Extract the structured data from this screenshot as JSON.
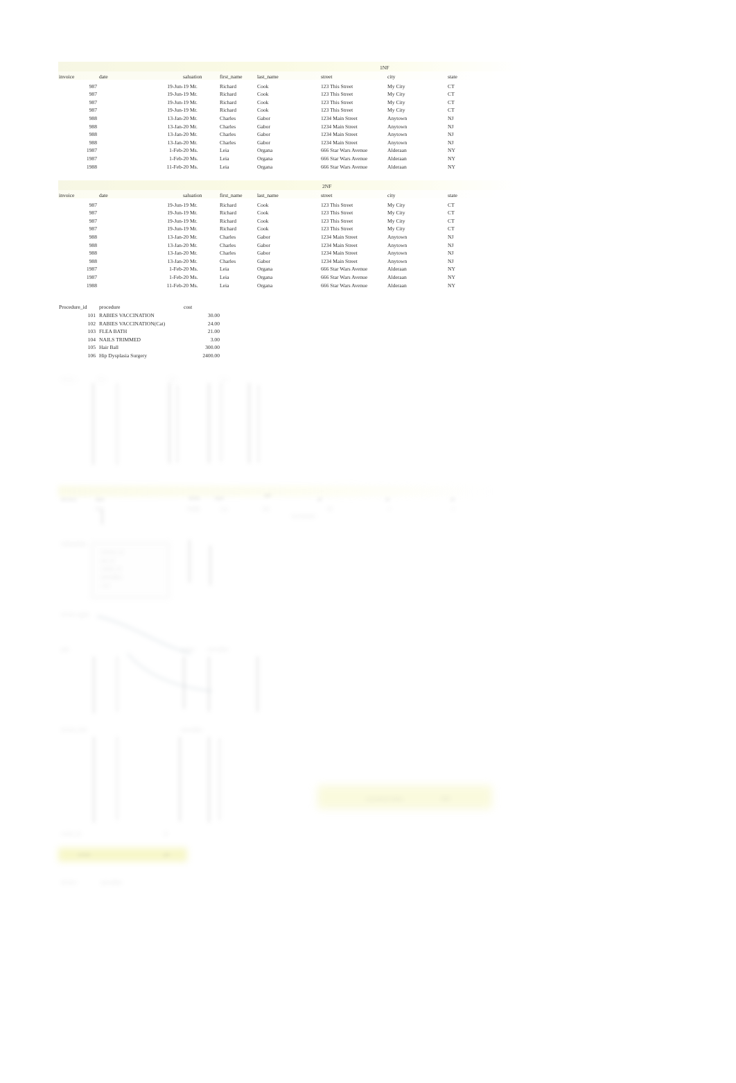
{
  "document": {
    "kind": "spreadsheet-normalization-worksheet",
    "background": "#ffffff",
    "text_color": "#2f2f2f",
    "band_color": "#fafae2",
    "highlight_color": "#f4f4b4"
  },
  "tables": {
    "nf1": {
      "title": "1NF",
      "columns": [
        "invoice",
        "date",
        "saluation",
        "first_name",
        "last_name",
        "street",
        "city",
        "state"
      ],
      "rows": [
        [
          "987",
          "19-Jun-19",
          "Mr.",
          "Richard",
          "Cook",
          "123 This Street",
          "My City",
          "CT"
        ],
        [
          "987",
          "19-Jun-19",
          "Mr.",
          "Richard",
          "Cook",
          "123 This Street",
          "My City",
          "CT"
        ],
        [
          "987",
          "19-Jun-19",
          "Mr.",
          "Richard",
          "Cook",
          "123 This Street",
          "My City",
          "CT"
        ],
        [
          "987",
          "19-Jun-19",
          "Mr.",
          "Richard",
          "Cook",
          "123 This Street",
          "My City",
          "CT"
        ],
        [
          "988",
          "13-Jan-20",
          "Mr.",
          "Charles",
          "Gabor",
          "1234 Main Street",
          "Anytown",
          "NJ"
        ],
        [
          "988",
          "13-Jan-20",
          "Mr.",
          "Charles",
          "Gabor",
          "1234 Main Street",
          "Anytown",
          "NJ"
        ],
        [
          "988",
          "13-Jan-20",
          "Mr.",
          "Charles",
          "Gabor",
          "1234 Main Street",
          "Anytown",
          "NJ"
        ],
        [
          "988",
          "13-Jan-20",
          "Mr.",
          "Charles",
          "Gabor",
          "1234 Main Street",
          "Anytown",
          "NJ"
        ],
        [
          "1987",
          "1-Feb-20",
          "Ms.",
          "Leia",
          "Organa",
          "666 Star Wars Avenue",
          "Alderaan",
          "NY"
        ],
        [
          "1987",
          "1-Feb-20",
          "Ms.",
          "Leia",
          "Organa",
          "666 Star Wars Avenue",
          "Alderaan",
          "NY"
        ],
        [
          "1988",
          "11-Feb-20",
          "Ms.",
          "Leia",
          "Organa",
          "666 Star Wars Avenue",
          "Alderaan",
          "NY"
        ]
      ]
    },
    "nf2": {
      "title": "2NF",
      "columns": [
        "invoice",
        "date",
        "saluation",
        "first_name",
        "last_name",
        "street",
        "city",
        "state"
      ],
      "rows": [
        [
          "987",
          "19-Jun-19",
          "Mr.",
          "Richard",
          "Cook",
          "123 This Street",
          "My City",
          "CT"
        ],
        [
          "987",
          "19-Jun-19",
          "Mr.",
          "Richard",
          "Cook",
          "123 This Street",
          "My City",
          "CT"
        ],
        [
          "987",
          "19-Jun-19",
          "Mr.",
          "Richard",
          "Cook",
          "123 This Street",
          "My City",
          "CT"
        ],
        [
          "987",
          "19-Jun-19",
          "Mr.",
          "Richard",
          "Cook",
          "123 This Street",
          "My City",
          "CT"
        ],
        [
          "988",
          "13-Jan-20",
          "Mr.",
          "Charles",
          "Gabor",
          "1234 Main Street",
          "Anytown",
          "NJ"
        ],
        [
          "988",
          "13-Jan-20",
          "Mr.",
          "Charles",
          "Gabor",
          "1234 Main Street",
          "Anytown",
          "NJ"
        ],
        [
          "988",
          "13-Jan-20",
          "Mr.",
          "Charles",
          "Gabor",
          "1234 Main Street",
          "Anytown",
          "NJ"
        ],
        [
          "988",
          "13-Jan-20",
          "Mr.",
          "Charles",
          "Gabor",
          "1234 Main Street",
          "Anytown",
          "NJ"
        ],
        [
          "1987",
          "1-Feb-20",
          "Ms.",
          "Leia",
          "Organa",
          "666 Star Wars Avenue",
          "Alderaan",
          "NY"
        ],
        [
          "1987",
          "1-Feb-20",
          "Ms.",
          "Leia",
          "Organa",
          "666 Star Wars Avenue",
          "Alderaan",
          "NY"
        ],
        [
          "1988",
          "11-Feb-20",
          "Ms.",
          "Leia",
          "Organa",
          "666 Star Wars Avenue",
          "Alderaan",
          "NY"
        ]
      ]
    },
    "procedure": {
      "columns": [
        "Procedure_id",
        "procedure",
        "cost"
      ],
      "rows": [
        [
          "101",
          "RABIES VACCINATION",
          "30.00"
        ],
        [
          "102",
          "RABIES VACCINATION(Cat)",
          "24.00"
        ],
        [
          "103",
          "FLEA BATH",
          "21.00"
        ],
        [
          "104",
          "NAILS TRIMMED",
          "3.00"
        ],
        [
          "105",
          "Hair Ball",
          "300.00"
        ],
        [
          "106",
          "Hip Dysplasia Surgery",
          "2400.00"
        ]
      ]
    }
  },
  "faded_region": {
    "note": "Lower half of the sheet is heavily faded / washed out; text is illegible in the source pixels.",
    "legible_text": ""
  }
}
